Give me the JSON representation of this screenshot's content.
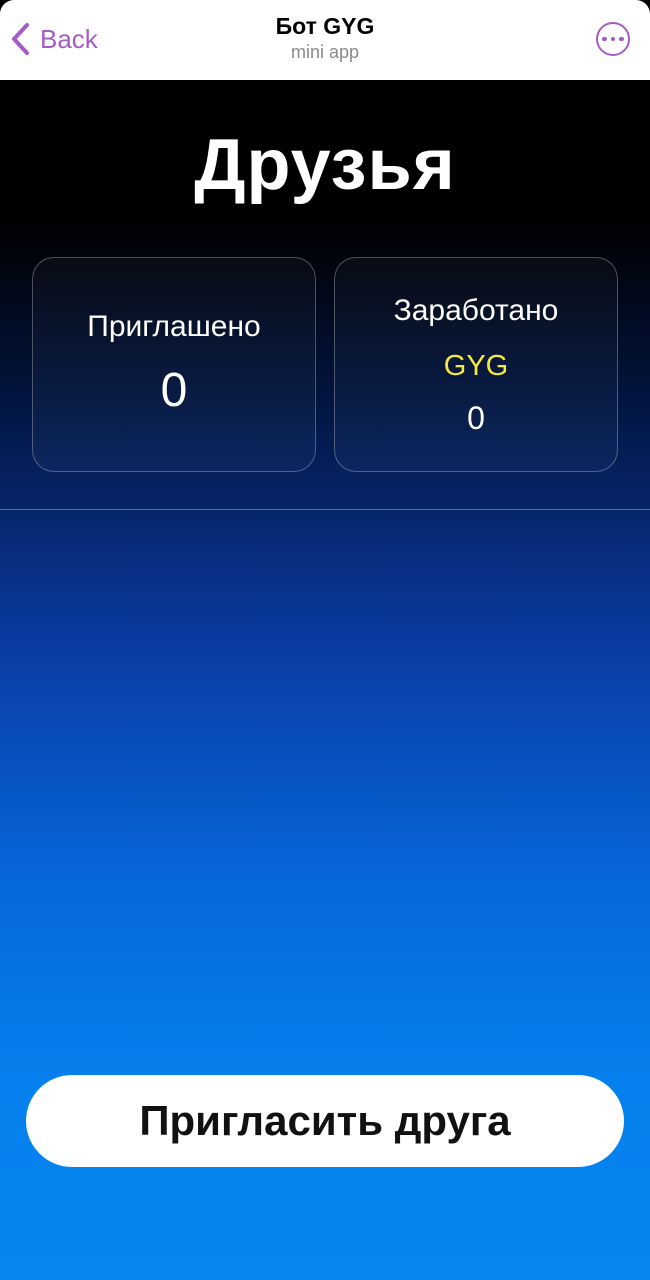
{
  "header": {
    "back_label": "Back",
    "title": "Бот GYG",
    "subtitle": "mini app",
    "accent_color": "#a45cc8"
  },
  "page": {
    "title": "Друзья"
  },
  "stats": {
    "invited": {
      "label": "Приглашено",
      "value": "0"
    },
    "earned": {
      "label": "Заработано",
      "currency": "GYG",
      "value": "0",
      "currency_color": "#f3ea3c"
    }
  },
  "footer": {
    "invite_button_label": "Пригласить друга"
  },
  "icons": {
    "back": "chevron-left-icon",
    "more": "more-dots-icon"
  }
}
